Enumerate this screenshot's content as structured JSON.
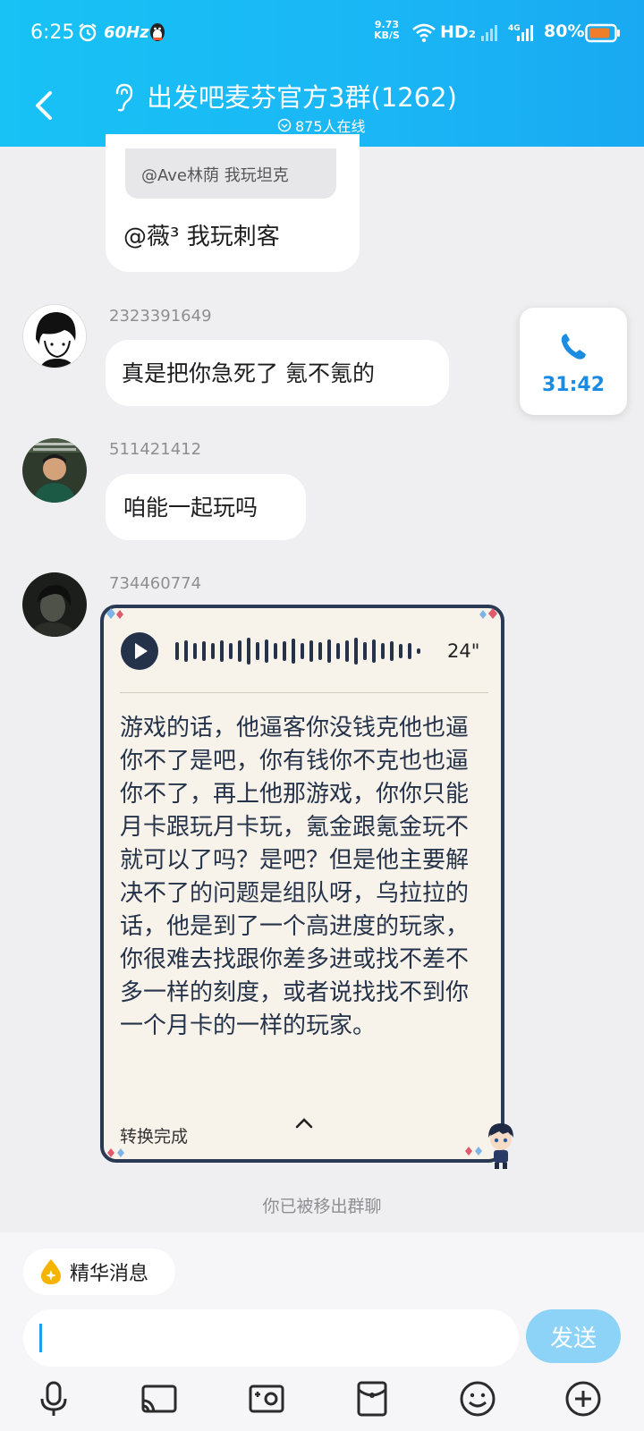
{
  "status_bar": {
    "time": "6:25",
    "refresh_rate": "60Hz",
    "net_speed_value": "9.73",
    "net_speed_unit": "KB/S",
    "hd_label": "HD₂",
    "battery": "80%"
  },
  "header": {
    "title": "出发吧麦芬官方3群(1262)",
    "online": "875人在线"
  },
  "messages": {
    "quoted_text": "@Ave林荫 我玩坦克",
    "reply_text": "@薇³ 我玩刺客",
    "msg1_sender": "2323391649",
    "msg1_text": "真是把你急死了 氪不氪的",
    "msg2_sender": "511421412",
    "msg2_text": "咱能一起玩吗",
    "msg3_sender": "734460774",
    "voice_duration": "24\"",
    "transcript": "游戏的话，他逼客你没钱克他也逼你不了是吧，你有钱你不克也也逼你不了，再上他那游戏，你你只能月卡跟玩月卡玩，氪金跟氪金玩不就可以了吗？是吧？但是他主要解决不了的问题是组队呀，乌拉拉的话，他是到了一个高进度的玩家，你很难去找跟你差多进或找不差不多一样的刻度，或者说找找不到你一个月卡的一样的玩家。",
    "convert_status": "转换完成"
  },
  "call": {
    "duration": "31:42"
  },
  "system_note": "你已被移出群聊",
  "input_bar": {
    "essence_label": "精华消息",
    "input_value": "",
    "send_label": "发送"
  },
  "toolbar_icons": [
    "microphone-icon",
    "cast-icon",
    "image-gallery-icon",
    "red-packet-icon",
    "emoji-icon",
    "add-icon"
  ],
  "colors": {
    "header": "#18c2f5",
    "accent": "#1c8ce2",
    "send_button": "#8dd3f7",
    "voice_card_border": "#2a3a55"
  }
}
